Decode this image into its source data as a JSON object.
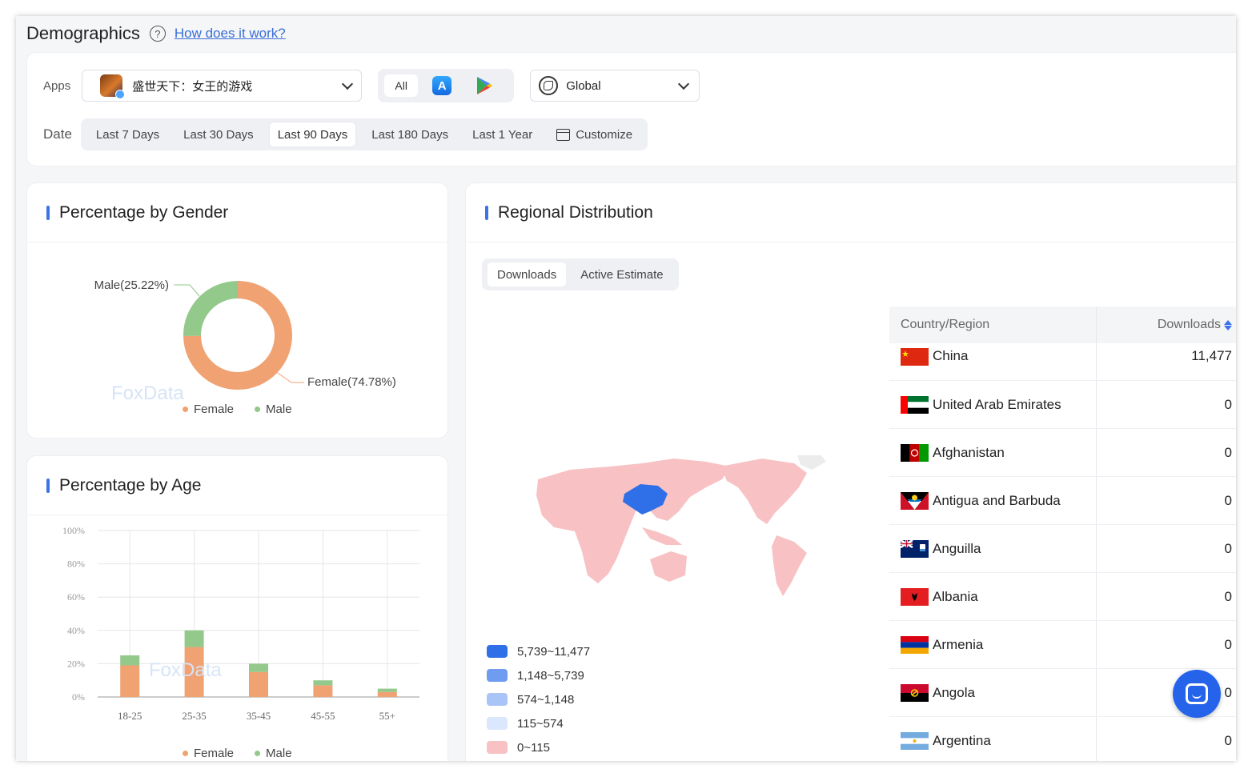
{
  "header": {
    "title": "Demographics",
    "help_link": "How does it work?"
  },
  "filters": {
    "apps_label": "Apps",
    "app_name": "盛世天下：女王的游戏",
    "store_all": "All",
    "region": "Global",
    "date_label": "Date",
    "date_options": [
      "Last 7 Days",
      "Last 30 Days",
      "Last 90 Days",
      "Last 180 Days",
      "Last 1 Year"
    ],
    "customize": "Customize",
    "active_date": "Last 90 Days"
  },
  "gender": {
    "title": "Percentage by Gender",
    "male_label": "Male(25.22%)",
    "female_label": "Female(74.78%)",
    "legend_female": "Female",
    "legend_male": "Male",
    "watermark": "FoxData"
  },
  "age": {
    "title": "Percentage by Age",
    "legend_female": "Female",
    "legend_male": "Male",
    "watermark": "FoxData"
  },
  "chart_data": [
    {
      "type": "pie",
      "labels": [
        "Female",
        "Male"
      ],
      "values": [
        74.78,
        25.22
      ],
      "colors": [
        "#f0a272",
        "#93c98a"
      ]
    },
    {
      "type": "bar",
      "stacked": true,
      "categories": [
        "18-25",
        "25-35",
        "35-45",
        "45-55",
        "55+"
      ],
      "series": [
        {
          "name": "Female",
          "values": [
            19,
            30,
            15,
            7,
            3
          ],
          "color": "#f0a272"
        },
        {
          "name": "Male",
          "values": [
            6,
            10,
            5,
            3,
            2
          ],
          "color": "#93c98a"
        }
      ],
      "ylim": [
        0,
        100
      ],
      "yticks": [
        "0%",
        "20%",
        "40%",
        "60%",
        "80%",
        "100%"
      ],
      "grid": true
    }
  ],
  "region": {
    "title": "Regional Distribution",
    "tabs": [
      "Downloads",
      "Active Estimate"
    ],
    "active_tab": "Downloads",
    "scale": [
      {
        "label": "5,739~11,477",
        "color": "#2f6fe8"
      },
      {
        "label": "1,148~5,739",
        "color": "#6f9bf0"
      },
      {
        "label": "574~1,148",
        "color": "#a9c4f7"
      },
      {
        "label": "115~574",
        "color": "#dbe7fc"
      },
      {
        "label": "0~115",
        "color": "#f8c2c4"
      }
    ],
    "table": {
      "col1": "Country/Region",
      "col2": "Downloads",
      "rows": [
        {
          "country": "China",
          "value": "11,477"
        },
        {
          "country": "United Arab Emirates",
          "value": "0"
        },
        {
          "country": "Afghanistan",
          "value": "0"
        },
        {
          "country": "Antigua and Barbuda",
          "value": "0"
        },
        {
          "country": "Anguilla",
          "value": "0"
        },
        {
          "country": "Albania",
          "value": "0"
        },
        {
          "country": "Armenia",
          "value": "0"
        },
        {
          "country": "Angola",
          "value": "0"
        },
        {
          "country": "Argentina",
          "value": "0"
        }
      ]
    }
  },
  "icons": {
    "help": "question-circle-icon",
    "chevron": "chevron-down-icon",
    "apple": "app-store-icon",
    "play": "google-play-icon",
    "globe": "globe-icon",
    "calendar": "calendar-icon",
    "chat": "chat-icon"
  }
}
